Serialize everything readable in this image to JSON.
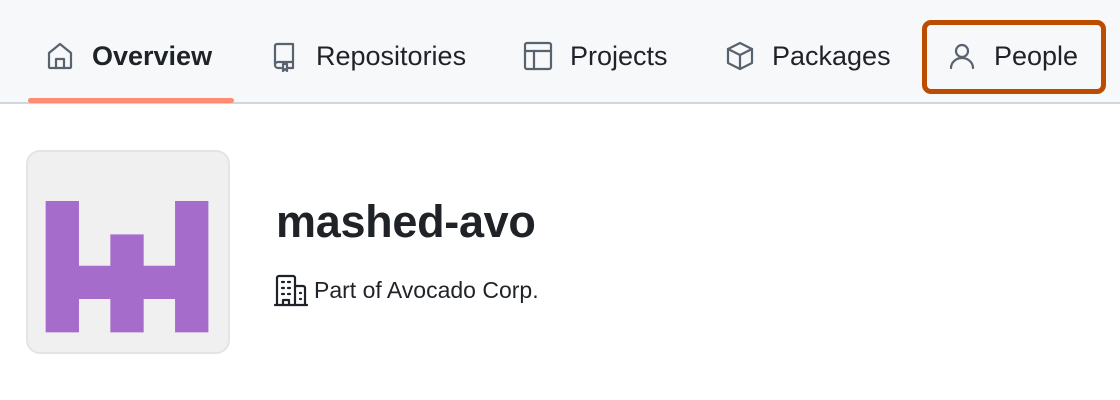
{
  "nav": {
    "tabs": [
      {
        "label": "Overview",
        "icon": "home-icon",
        "selected": true
      },
      {
        "label": "Repositories",
        "icon": "repo-icon",
        "selected": false
      },
      {
        "label": "Projects",
        "icon": "table-icon",
        "selected": false
      },
      {
        "label": "Packages",
        "icon": "package-icon",
        "selected": false
      },
      {
        "label": "People",
        "icon": "person-icon",
        "selected": false,
        "highlighted": true
      }
    ],
    "selected_underline_color": "#fd8c73",
    "highlight_color": "#bc4c00"
  },
  "org": {
    "name": "mashed-avo",
    "avatar_color": "#a66ccc",
    "enterprise_text": "Part of Avocado Corp.",
    "enterprise_icon": "organization-icon"
  }
}
